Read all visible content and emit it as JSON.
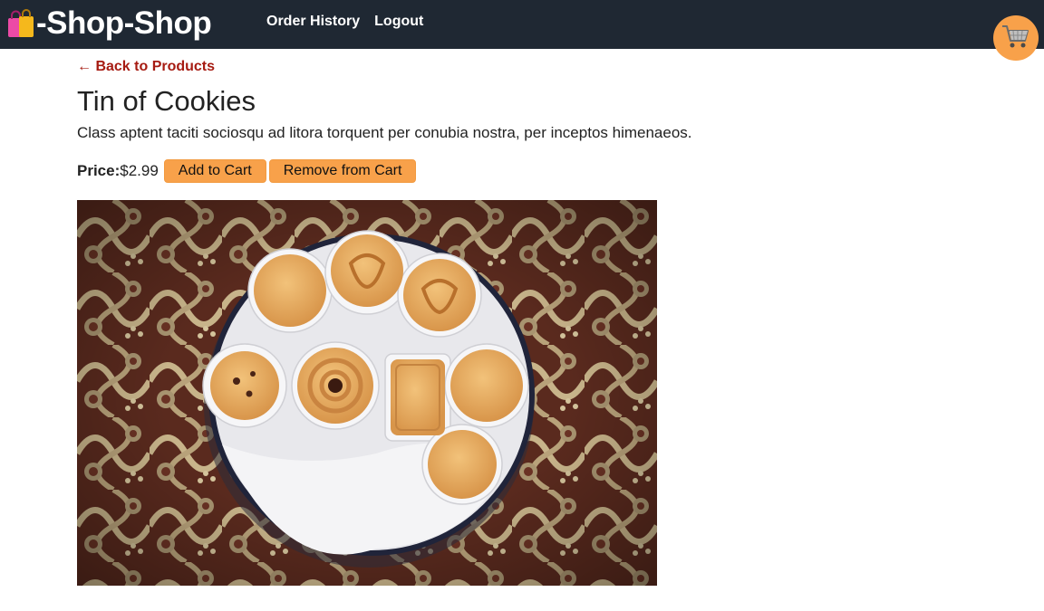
{
  "nav": {
    "brand_icon": "shopping-bags-icon",
    "brand_text": "-Shop-Shop",
    "links": [
      "Order History",
      "Logout"
    ],
    "cart_icon": "shopping-cart-icon"
  },
  "product": {
    "back_label": "← Back to Products",
    "title": "Tin of Cookies",
    "description": "Class aptent taciti sociosqu ad litora torquent per conubia nostra, per inceptos himenaeos.",
    "price_label": "Price:",
    "price": "$2.99",
    "add_label": "Add to Cart",
    "remove_label": "Remove from Cart",
    "image_alt": "Tin of Cookies"
  },
  "colors": {
    "navbar": "#1f2833",
    "accent": "#f8a14a",
    "link": "#a61b12"
  }
}
